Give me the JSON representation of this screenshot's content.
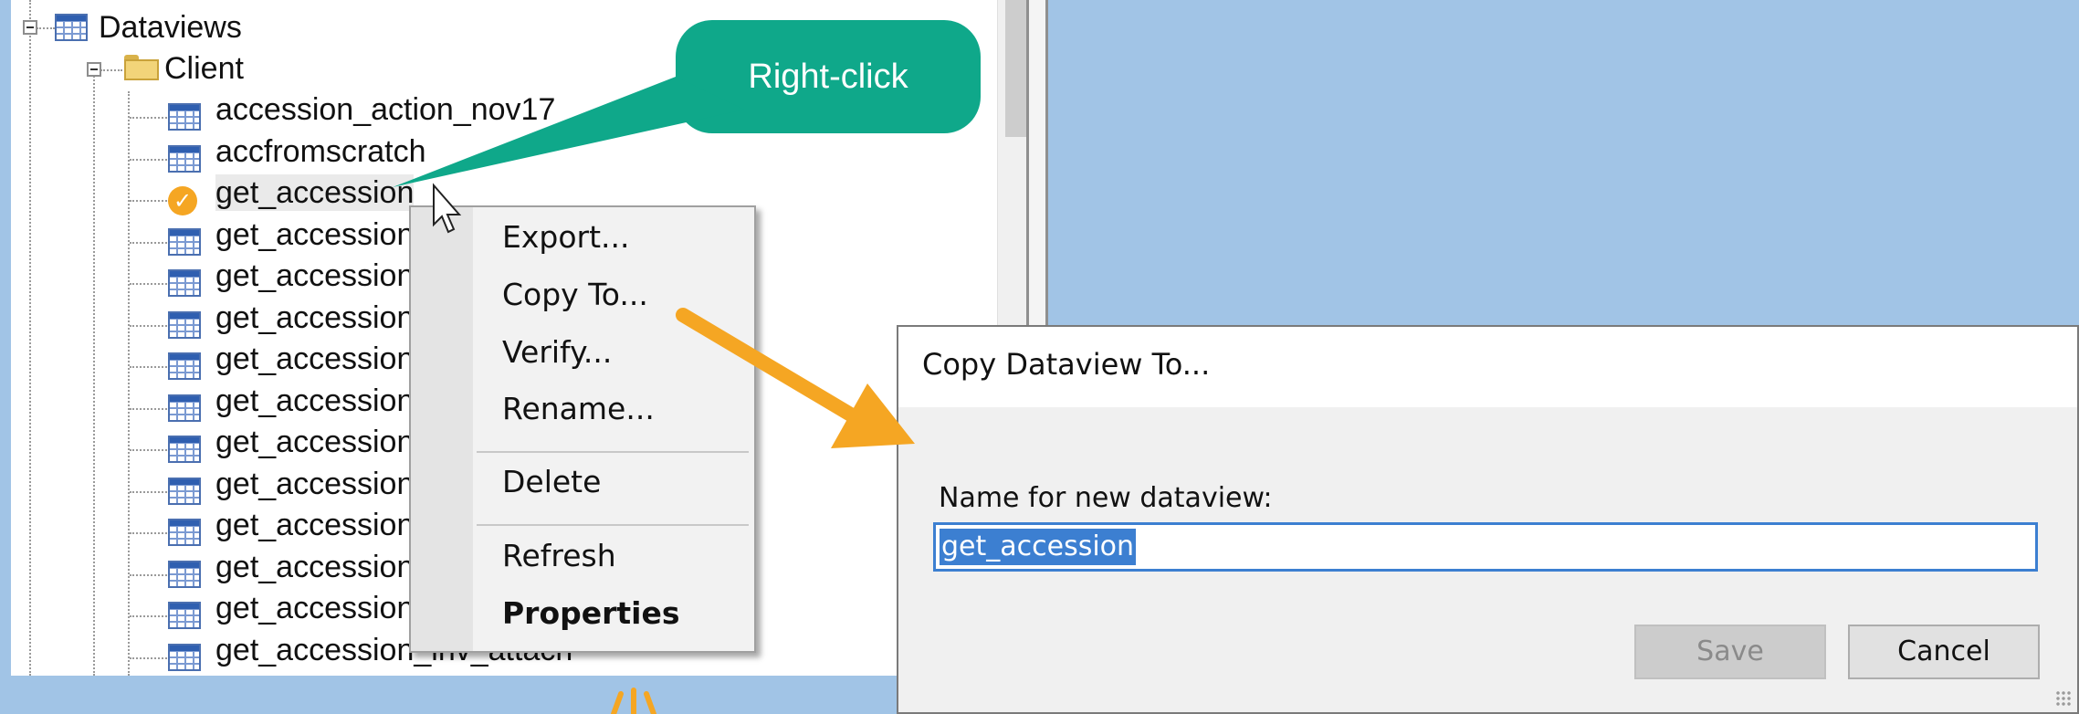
{
  "tree": {
    "root_label": "Dataviews",
    "folder_label": "Client",
    "items": [
      {
        "label": "accession_action_nov17",
        "icon": "dataview-grid-icon"
      },
      {
        "label": "accfromscratch",
        "icon": "dataview-grid-icon"
      },
      {
        "label": "get_accession",
        "icon": "checkmark-icon",
        "selected": true
      },
      {
        "label": "get_accession",
        "icon": "dataview-grid-icon"
      },
      {
        "label": "get_accession",
        "icon": "dataview-grid-icon"
      },
      {
        "label": "get_accession",
        "icon": "dataview-grid-icon"
      },
      {
        "label": "get_accession",
        "icon": "dataview-grid-icon"
      },
      {
        "label": "get_accession",
        "icon": "dataview-grid-icon"
      },
      {
        "label": "get_accession",
        "icon": "dataview-grid-icon"
      },
      {
        "label": "get_accession",
        "icon": "dataview-grid-icon"
      },
      {
        "label": "get_accession",
        "icon": "dataview-grid-icon"
      },
      {
        "label": "get_accession",
        "icon": "dataview-grid-icon"
      },
      {
        "label": "get_accession",
        "icon": "dataview-grid-icon"
      },
      {
        "label": "get_accession_inv_attach",
        "icon": "dataview-grid-icon"
      }
    ]
  },
  "context_menu": {
    "items": [
      "Export...",
      "Copy To...",
      "Verify...",
      "Rename...",
      "Delete",
      "Refresh",
      "Properties"
    ]
  },
  "callout": {
    "text": "Right-click",
    "color": "#0fa88a"
  },
  "arrow_color": "#f5a623",
  "dialog": {
    "title": "Copy Dataview To...",
    "name_label": "Name for new dataview:",
    "name_value": "get_accession",
    "save_label": "Save",
    "cancel_label": "Cancel"
  },
  "colors": {
    "background": "#a1c4e6",
    "selection": "#3c7fd1"
  }
}
